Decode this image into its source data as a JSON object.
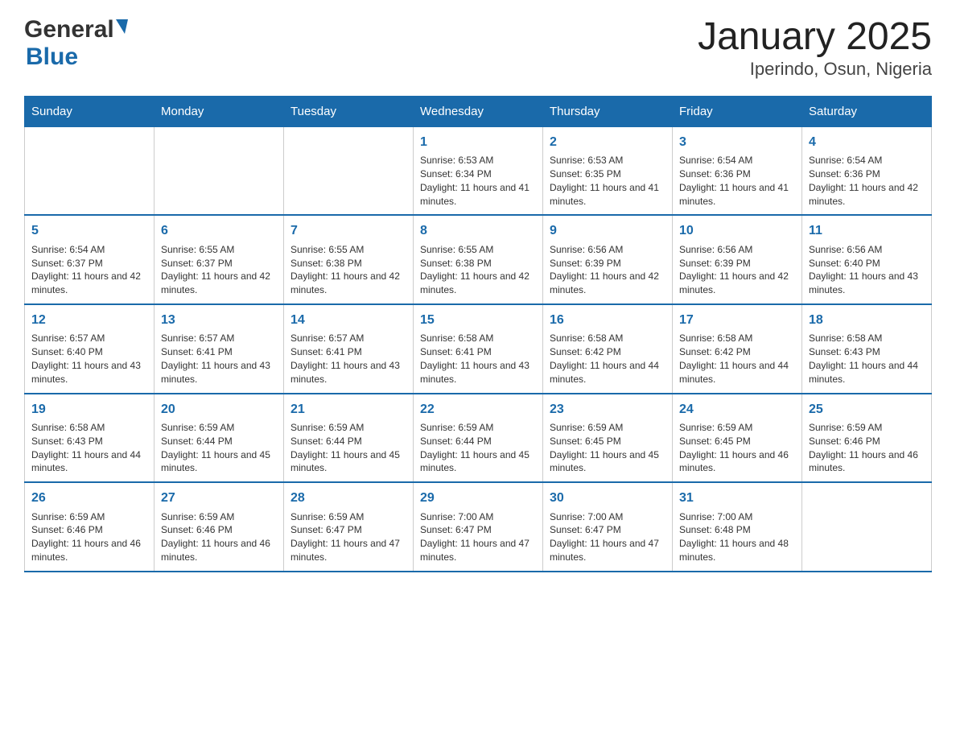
{
  "header": {
    "logo_general": "General",
    "logo_blue": "Blue",
    "title": "January 2025",
    "subtitle": "Iperindo, Osun, Nigeria"
  },
  "weekdays": [
    "Sunday",
    "Monday",
    "Tuesday",
    "Wednesday",
    "Thursday",
    "Friday",
    "Saturday"
  ],
  "weeks": [
    [
      {
        "day": "",
        "info": ""
      },
      {
        "day": "",
        "info": ""
      },
      {
        "day": "",
        "info": ""
      },
      {
        "day": "1",
        "info": "Sunrise: 6:53 AM\nSunset: 6:34 PM\nDaylight: 11 hours and 41 minutes."
      },
      {
        "day": "2",
        "info": "Sunrise: 6:53 AM\nSunset: 6:35 PM\nDaylight: 11 hours and 41 minutes."
      },
      {
        "day": "3",
        "info": "Sunrise: 6:54 AM\nSunset: 6:36 PM\nDaylight: 11 hours and 41 minutes."
      },
      {
        "day": "4",
        "info": "Sunrise: 6:54 AM\nSunset: 6:36 PM\nDaylight: 11 hours and 42 minutes."
      }
    ],
    [
      {
        "day": "5",
        "info": "Sunrise: 6:54 AM\nSunset: 6:37 PM\nDaylight: 11 hours and 42 minutes."
      },
      {
        "day": "6",
        "info": "Sunrise: 6:55 AM\nSunset: 6:37 PM\nDaylight: 11 hours and 42 minutes."
      },
      {
        "day": "7",
        "info": "Sunrise: 6:55 AM\nSunset: 6:38 PM\nDaylight: 11 hours and 42 minutes."
      },
      {
        "day": "8",
        "info": "Sunrise: 6:55 AM\nSunset: 6:38 PM\nDaylight: 11 hours and 42 minutes."
      },
      {
        "day": "9",
        "info": "Sunrise: 6:56 AM\nSunset: 6:39 PM\nDaylight: 11 hours and 42 minutes."
      },
      {
        "day": "10",
        "info": "Sunrise: 6:56 AM\nSunset: 6:39 PM\nDaylight: 11 hours and 42 minutes."
      },
      {
        "day": "11",
        "info": "Sunrise: 6:56 AM\nSunset: 6:40 PM\nDaylight: 11 hours and 43 minutes."
      }
    ],
    [
      {
        "day": "12",
        "info": "Sunrise: 6:57 AM\nSunset: 6:40 PM\nDaylight: 11 hours and 43 minutes."
      },
      {
        "day": "13",
        "info": "Sunrise: 6:57 AM\nSunset: 6:41 PM\nDaylight: 11 hours and 43 minutes."
      },
      {
        "day": "14",
        "info": "Sunrise: 6:57 AM\nSunset: 6:41 PM\nDaylight: 11 hours and 43 minutes."
      },
      {
        "day": "15",
        "info": "Sunrise: 6:58 AM\nSunset: 6:41 PM\nDaylight: 11 hours and 43 minutes."
      },
      {
        "day": "16",
        "info": "Sunrise: 6:58 AM\nSunset: 6:42 PM\nDaylight: 11 hours and 44 minutes."
      },
      {
        "day": "17",
        "info": "Sunrise: 6:58 AM\nSunset: 6:42 PM\nDaylight: 11 hours and 44 minutes."
      },
      {
        "day": "18",
        "info": "Sunrise: 6:58 AM\nSunset: 6:43 PM\nDaylight: 11 hours and 44 minutes."
      }
    ],
    [
      {
        "day": "19",
        "info": "Sunrise: 6:58 AM\nSunset: 6:43 PM\nDaylight: 11 hours and 44 minutes."
      },
      {
        "day": "20",
        "info": "Sunrise: 6:59 AM\nSunset: 6:44 PM\nDaylight: 11 hours and 45 minutes."
      },
      {
        "day": "21",
        "info": "Sunrise: 6:59 AM\nSunset: 6:44 PM\nDaylight: 11 hours and 45 minutes."
      },
      {
        "day": "22",
        "info": "Sunrise: 6:59 AM\nSunset: 6:44 PM\nDaylight: 11 hours and 45 minutes."
      },
      {
        "day": "23",
        "info": "Sunrise: 6:59 AM\nSunset: 6:45 PM\nDaylight: 11 hours and 45 minutes."
      },
      {
        "day": "24",
        "info": "Sunrise: 6:59 AM\nSunset: 6:45 PM\nDaylight: 11 hours and 46 minutes."
      },
      {
        "day": "25",
        "info": "Sunrise: 6:59 AM\nSunset: 6:46 PM\nDaylight: 11 hours and 46 minutes."
      }
    ],
    [
      {
        "day": "26",
        "info": "Sunrise: 6:59 AM\nSunset: 6:46 PM\nDaylight: 11 hours and 46 minutes."
      },
      {
        "day": "27",
        "info": "Sunrise: 6:59 AM\nSunset: 6:46 PM\nDaylight: 11 hours and 46 minutes."
      },
      {
        "day": "28",
        "info": "Sunrise: 6:59 AM\nSunset: 6:47 PM\nDaylight: 11 hours and 47 minutes."
      },
      {
        "day": "29",
        "info": "Sunrise: 7:00 AM\nSunset: 6:47 PM\nDaylight: 11 hours and 47 minutes."
      },
      {
        "day": "30",
        "info": "Sunrise: 7:00 AM\nSunset: 6:47 PM\nDaylight: 11 hours and 47 minutes."
      },
      {
        "day": "31",
        "info": "Sunrise: 7:00 AM\nSunset: 6:48 PM\nDaylight: 11 hours and 48 minutes."
      },
      {
        "day": "",
        "info": ""
      }
    ]
  ]
}
